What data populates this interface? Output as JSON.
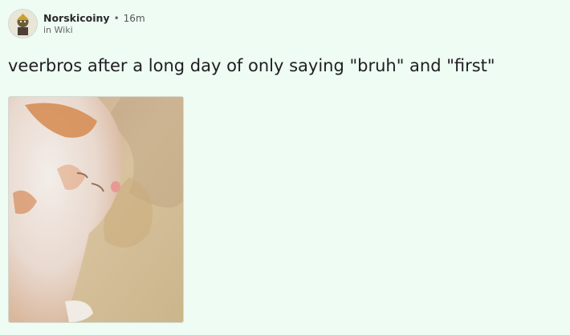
{
  "post": {
    "author": "Norskicoiny",
    "separator": "•",
    "time": "16m",
    "community": "in Wiki",
    "title": "veerbros after a long day of only saying \"bruh\" and \"first\"",
    "image": {
      "subject": "sleeping orange and white kitten icon",
      "alt": ""
    }
  },
  "icons": {
    "avatar": "user-avatar-icon"
  },
  "colors": {
    "background": "#eefcf3",
    "title_text": "#1f1f1f",
    "meta_text": "#555555"
  }
}
